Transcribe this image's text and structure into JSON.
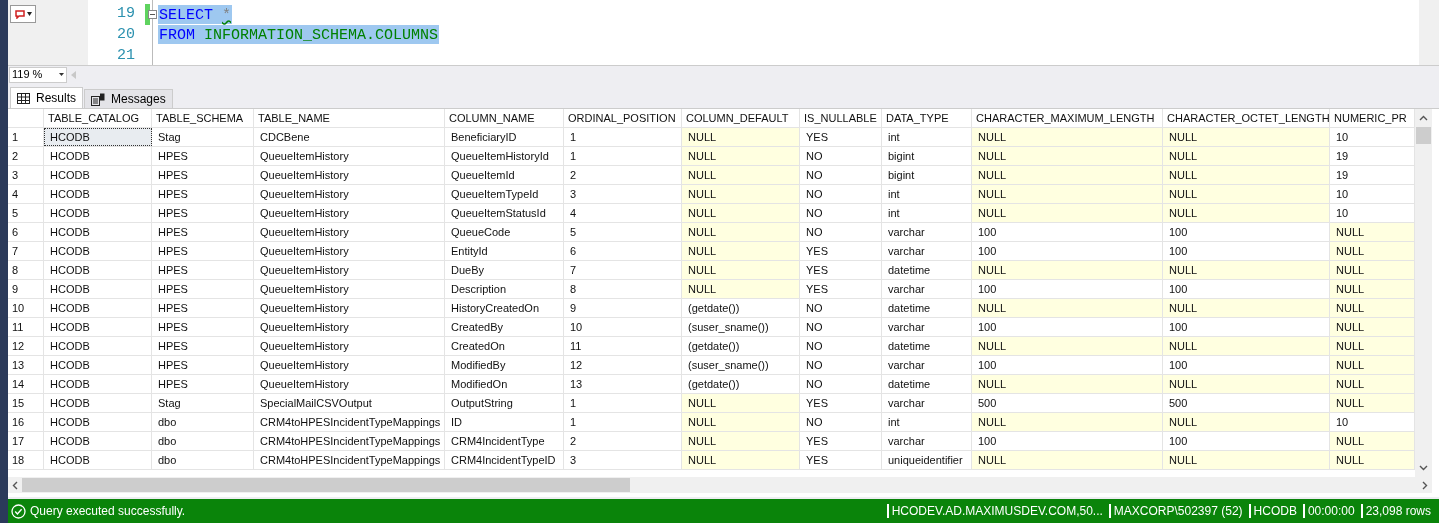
{
  "editor": {
    "lines": [
      {
        "number": "19",
        "modified": true,
        "selected": true,
        "tokens": [
          {
            "text": "SELECT",
            "kind": "keyword",
            "squiggle": false
          },
          {
            "text": "*",
            "kind": "operator",
            "squiggle": true
          }
        ]
      },
      {
        "number": "20",
        "modified": false,
        "selected": true,
        "tokens": [
          {
            "text": "FROM",
            "kind": "keyword",
            "squiggle": false
          },
          {
            "text": "INFORMATION_SCHEMA.COLUMNS",
            "kind": "object",
            "squiggle": false
          }
        ]
      },
      {
        "number": "21",
        "modified": false,
        "selected": false
      }
    ],
    "zoom": "119 %"
  },
  "tabs": [
    {
      "label": "Results",
      "kind": "grid",
      "selected": true
    },
    {
      "label": "Messages",
      "kind": "messages",
      "selected": false
    }
  ],
  "table": {
    "columns": [
      "TABLE_CATALOG",
      "TABLE_SCHEMA",
      "TABLE_NAME",
      "COLUMN_NAME",
      "ORDINAL_POSITION",
      "COLUMN_DEFAULT",
      "IS_NULLABLE",
      "DATA_TYPE",
      "CHARACTER_MAXIMUM_LENGTH",
      "CHARACTER_OCTET_LENGTH",
      "NUMERIC_PR"
    ],
    "rows": [
      {
        "number": "1",
        "focused": true,
        "cells": [
          {
            "text": "HCODB",
            "null": false
          },
          {
            "text": "Stag",
            "null": false
          },
          {
            "text": "CDCBene",
            "null": false
          },
          {
            "text": "BeneficiaryID",
            "null": false
          },
          {
            "text": "1",
            "null": false
          },
          {
            "text": "NULL",
            "null": true
          },
          {
            "text": "YES",
            "null": false
          },
          {
            "text": "int",
            "null": false
          },
          {
            "text": "NULL",
            "null": true
          },
          {
            "text": "NULL",
            "null": true
          },
          {
            "text": "10",
            "null": false
          }
        ]
      },
      {
        "number": "2",
        "focused": false,
        "cells": [
          {
            "text": "HCODB",
            "null": false
          },
          {
            "text": "HPES",
            "null": false
          },
          {
            "text": "QueueItemHistory",
            "null": false
          },
          {
            "text": "QueueItemHistoryId",
            "null": false
          },
          {
            "text": "1",
            "null": false
          },
          {
            "text": "NULL",
            "null": true
          },
          {
            "text": "NO",
            "null": false
          },
          {
            "text": "bigint",
            "null": false
          },
          {
            "text": "NULL",
            "null": true
          },
          {
            "text": "NULL",
            "null": true
          },
          {
            "text": "19",
            "null": false
          }
        ]
      },
      {
        "number": "3",
        "focused": false,
        "cells": [
          {
            "text": "HCODB",
            "null": false
          },
          {
            "text": "HPES",
            "null": false
          },
          {
            "text": "QueueItemHistory",
            "null": false
          },
          {
            "text": "QueueItemId",
            "null": false
          },
          {
            "text": "2",
            "null": false
          },
          {
            "text": "NULL",
            "null": true
          },
          {
            "text": "NO",
            "null": false
          },
          {
            "text": "bigint",
            "null": false
          },
          {
            "text": "NULL",
            "null": true
          },
          {
            "text": "NULL",
            "null": true
          },
          {
            "text": "19",
            "null": false
          }
        ]
      },
      {
        "number": "4",
        "focused": false,
        "cells": [
          {
            "text": "HCODB",
            "null": false
          },
          {
            "text": "HPES",
            "null": false
          },
          {
            "text": "QueueItemHistory",
            "null": false
          },
          {
            "text": "QueueItemTypeId",
            "null": false
          },
          {
            "text": "3",
            "null": false
          },
          {
            "text": "NULL",
            "null": true
          },
          {
            "text": "NO",
            "null": false
          },
          {
            "text": "int",
            "null": false
          },
          {
            "text": "NULL",
            "null": true
          },
          {
            "text": "NULL",
            "null": true
          },
          {
            "text": "10",
            "null": false
          }
        ]
      },
      {
        "number": "5",
        "focused": false,
        "cells": [
          {
            "text": "HCODB",
            "null": false
          },
          {
            "text": "HPES",
            "null": false
          },
          {
            "text": "QueueItemHistory",
            "null": false
          },
          {
            "text": "QueueItemStatusId",
            "null": false
          },
          {
            "text": "4",
            "null": false
          },
          {
            "text": "NULL",
            "null": true
          },
          {
            "text": "NO",
            "null": false
          },
          {
            "text": "int",
            "null": false
          },
          {
            "text": "NULL",
            "null": true
          },
          {
            "text": "NULL",
            "null": true
          },
          {
            "text": "10",
            "null": false
          }
        ]
      },
      {
        "number": "6",
        "focused": false,
        "cells": [
          {
            "text": "HCODB",
            "null": false
          },
          {
            "text": "HPES",
            "null": false
          },
          {
            "text": "QueueItemHistory",
            "null": false
          },
          {
            "text": "QueueCode",
            "null": false
          },
          {
            "text": "5",
            "null": false
          },
          {
            "text": "NULL",
            "null": true
          },
          {
            "text": "NO",
            "null": false
          },
          {
            "text": "varchar",
            "null": false
          },
          {
            "text": "100",
            "null": false
          },
          {
            "text": "100",
            "null": false
          },
          {
            "text": "NULL",
            "null": true
          }
        ]
      },
      {
        "number": "7",
        "focused": false,
        "cells": [
          {
            "text": "HCODB",
            "null": false
          },
          {
            "text": "HPES",
            "null": false
          },
          {
            "text": "QueueItemHistory",
            "null": false
          },
          {
            "text": "EntityId",
            "null": false
          },
          {
            "text": "6",
            "null": false
          },
          {
            "text": "NULL",
            "null": true
          },
          {
            "text": "YES",
            "null": false
          },
          {
            "text": "varchar",
            "null": false
          },
          {
            "text": "100",
            "null": false
          },
          {
            "text": "100",
            "null": false
          },
          {
            "text": "NULL",
            "null": true
          }
        ]
      },
      {
        "number": "8",
        "focused": false,
        "cells": [
          {
            "text": "HCODB",
            "null": false
          },
          {
            "text": "HPES",
            "null": false
          },
          {
            "text": "QueueItemHistory",
            "null": false
          },
          {
            "text": "DueBy",
            "null": false
          },
          {
            "text": "7",
            "null": false
          },
          {
            "text": "NULL",
            "null": true
          },
          {
            "text": "YES",
            "null": false
          },
          {
            "text": "datetime",
            "null": false
          },
          {
            "text": "NULL",
            "null": true
          },
          {
            "text": "NULL",
            "null": true
          },
          {
            "text": "NULL",
            "null": true
          }
        ]
      },
      {
        "number": "9",
        "focused": false,
        "cells": [
          {
            "text": "HCODB",
            "null": false
          },
          {
            "text": "HPES",
            "null": false
          },
          {
            "text": "QueueItemHistory",
            "null": false
          },
          {
            "text": "Description",
            "null": false
          },
          {
            "text": "8",
            "null": false
          },
          {
            "text": "NULL",
            "null": true
          },
          {
            "text": "YES",
            "null": false
          },
          {
            "text": "varchar",
            "null": false
          },
          {
            "text": "100",
            "null": false
          },
          {
            "text": "100",
            "null": false
          },
          {
            "text": "NULL",
            "null": true
          }
        ]
      },
      {
        "number": "10",
        "focused": false,
        "cells": [
          {
            "text": "HCODB",
            "null": false
          },
          {
            "text": "HPES",
            "null": false
          },
          {
            "text": "QueueItemHistory",
            "null": false
          },
          {
            "text": "HistoryCreatedOn",
            "null": false
          },
          {
            "text": "9",
            "null": false
          },
          {
            "text": "(getdate())",
            "null": false
          },
          {
            "text": "NO",
            "null": false
          },
          {
            "text": "datetime",
            "null": false
          },
          {
            "text": "NULL",
            "null": true
          },
          {
            "text": "NULL",
            "null": true
          },
          {
            "text": "NULL",
            "null": true
          }
        ]
      },
      {
        "number": "11",
        "focused": false,
        "cells": [
          {
            "text": "HCODB",
            "null": false
          },
          {
            "text": "HPES",
            "null": false
          },
          {
            "text": "QueueItemHistory",
            "null": false
          },
          {
            "text": "CreatedBy",
            "null": false
          },
          {
            "text": "10",
            "null": false
          },
          {
            "text": "(suser_sname())",
            "null": false
          },
          {
            "text": "NO",
            "null": false
          },
          {
            "text": "varchar",
            "null": false
          },
          {
            "text": "100",
            "null": false
          },
          {
            "text": "100",
            "null": false
          },
          {
            "text": "NULL",
            "null": true
          }
        ]
      },
      {
        "number": "12",
        "focused": false,
        "cells": [
          {
            "text": "HCODB",
            "null": false
          },
          {
            "text": "HPES",
            "null": false
          },
          {
            "text": "QueueItemHistory",
            "null": false
          },
          {
            "text": "CreatedOn",
            "null": false
          },
          {
            "text": "11",
            "null": false
          },
          {
            "text": "(getdate())",
            "null": false
          },
          {
            "text": "NO",
            "null": false
          },
          {
            "text": "datetime",
            "null": false
          },
          {
            "text": "NULL",
            "null": true
          },
          {
            "text": "NULL",
            "null": true
          },
          {
            "text": "NULL",
            "null": true
          }
        ]
      },
      {
        "number": "13",
        "focused": false,
        "cells": [
          {
            "text": "HCODB",
            "null": false
          },
          {
            "text": "HPES",
            "null": false
          },
          {
            "text": "QueueItemHistory",
            "null": false
          },
          {
            "text": "ModifiedBy",
            "null": false
          },
          {
            "text": "12",
            "null": false
          },
          {
            "text": "(suser_sname())",
            "null": false
          },
          {
            "text": "NO",
            "null": false
          },
          {
            "text": "varchar",
            "null": false
          },
          {
            "text": "100",
            "null": false
          },
          {
            "text": "100",
            "null": false
          },
          {
            "text": "NULL",
            "null": true
          }
        ]
      },
      {
        "number": "14",
        "focused": false,
        "cells": [
          {
            "text": "HCODB",
            "null": false
          },
          {
            "text": "HPES",
            "null": false
          },
          {
            "text": "QueueItemHistory",
            "null": false
          },
          {
            "text": "ModifiedOn",
            "null": false
          },
          {
            "text": "13",
            "null": false
          },
          {
            "text": "(getdate())",
            "null": false
          },
          {
            "text": "NO",
            "null": false
          },
          {
            "text": "datetime",
            "null": false
          },
          {
            "text": "NULL",
            "null": true
          },
          {
            "text": "NULL",
            "null": true
          },
          {
            "text": "NULL",
            "null": true
          }
        ]
      },
      {
        "number": "15",
        "focused": false,
        "cells": [
          {
            "text": "HCODB",
            "null": false
          },
          {
            "text": "Stag",
            "null": false
          },
          {
            "text": "SpecialMailCSVOutput",
            "null": false
          },
          {
            "text": "OutputString",
            "null": false
          },
          {
            "text": "1",
            "null": false
          },
          {
            "text": "NULL",
            "null": true
          },
          {
            "text": "YES",
            "null": false
          },
          {
            "text": "varchar",
            "null": false
          },
          {
            "text": "500",
            "null": false
          },
          {
            "text": "500",
            "null": false
          },
          {
            "text": "NULL",
            "null": true
          }
        ]
      },
      {
        "number": "16",
        "focused": false,
        "cells": [
          {
            "text": "HCODB",
            "null": false
          },
          {
            "text": "dbo",
            "null": false
          },
          {
            "text": "CRM4toHPESIncidentTypeMappings",
            "null": false
          },
          {
            "text": "ID",
            "null": false
          },
          {
            "text": "1",
            "null": false
          },
          {
            "text": "NULL",
            "null": true
          },
          {
            "text": "NO",
            "null": false
          },
          {
            "text": "int",
            "null": false
          },
          {
            "text": "NULL",
            "null": true
          },
          {
            "text": "NULL",
            "null": true
          },
          {
            "text": "10",
            "null": false
          }
        ]
      },
      {
        "number": "17",
        "focused": false,
        "cells": [
          {
            "text": "HCODB",
            "null": false
          },
          {
            "text": "dbo",
            "null": false
          },
          {
            "text": "CRM4toHPESIncidentTypeMappings",
            "null": false
          },
          {
            "text": "CRM4IncidentType",
            "null": false
          },
          {
            "text": "2",
            "null": false
          },
          {
            "text": "NULL",
            "null": true
          },
          {
            "text": "YES",
            "null": false
          },
          {
            "text": "varchar",
            "null": false
          },
          {
            "text": "100",
            "null": false
          },
          {
            "text": "100",
            "null": false
          },
          {
            "text": "NULL",
            "null": true
          }
        ]
      },
      {
        "number": "18",
        "focused": false,
        "cells": [
          {
            "text": "HCODB",
            "null": false
          },
          {
            "text": "dbo",
            "null": false
          },
          {
            "text": "CRM4toHPESIncidentTypeMappings",
            "null": false
          },
          {
            "text": "CRM4IncidentTypeID",
            "null": false
          },
          {
            "text": "3",
            "null": false
          },
          {
            "text": "NULL",
            "null": true
          },
          {
            "text": "YES",
            "null": false
          },
          {
            "text": "uniqueidentifier",
            "null": false
          },
          {
            "text": "NULL",
            "null": true
          },
          {
            "text": "NULL",
            "null": true
          },
          {
            "text": "NULL",
            "null": true
          }
        ]
      }
    ]
  },
  "status_bar": {
    "message": "Query executed successfully.",
    "segments": [
      "HCODEV.AD.MAXIMUSDEV.COM,50...",
      "MAXCORP\\502397 (52)",
      "HCODB",
      "00:00:00",
      "23,098 rows"
    ]
  }
}
